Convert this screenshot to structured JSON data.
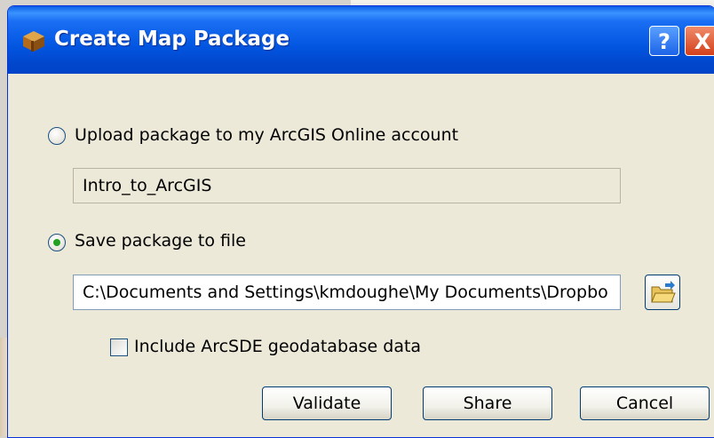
{
  "window": {
    "title": "Create Map Package",
    "help_label": "?",
    "close_label": "X"
  },
  "upload_option": {
    "label": "Upload package to my ArcGIS Online account",
    "selected": false,
    "field_value": "Intro_to_ArcGIS"
  },
  "file_option": {
    "label": "Save package to file",
    "selected": true,
    "path_value": "C:\\Documents and Settings\\kmdoughe\\My Documents\\Dropbo"
  },
  "include_sde": {
    "label": "Include ArcSDE geodatabase data",
    "checked": false
  },
  "buttons": {
    "validate": "Validate",
    "share": "Share",
    "cancel": "Cancel"
  },
  "colors": {
    "titlebar": "#0255e0",
    "dialog_bg": "#ece9d8",
    "radio_dot": "#21a121"
  }
}
